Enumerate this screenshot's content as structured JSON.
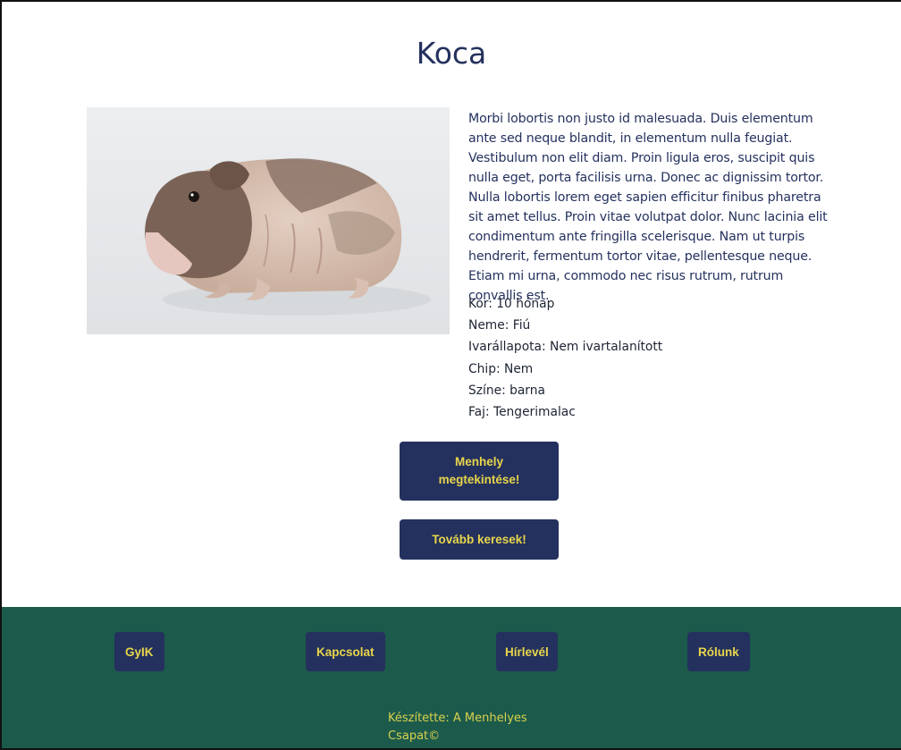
{
  "pet": {
    "name": "Koca",
    "photo_icon": "guinea-pig-photo",
    "description": "Morbi lobortis non justo id malesuada. Duis elementum ante sed neque blandit, in elementum nulla feugiat. Vestibulum non elit diam. Proin ligula eros, suscipit quis nulla eget, porta facilisis urna. Donec ac dignissim tortor. Nulla lobortis lorem eget sapien efficitur finibus pharetra sit amet tellus. Proin vitae volutpat dolor. Nunc lacinia elit condimentum ante fringilla scelerisque. Nam ut turpis hendrerit, fermentum tortor vitae, pellentesque neque. Etiam mi urna, commodo nec risus rutrum, rutrum convallis est.",
    "facts": [
      "Kor: 10 hónap",
      "Neme: Fiú",
      "Ivarállapota: Nem ivartalanított",
      "Chip: Nem",
      "Színe: barna",
      "Faj: Tengerimalac"
    ]
  },
  "actions": {
    "view_shelter": "Menhely megtekintése!",
    "keep_searching": "Tovább keresek!"
  },
  "footer": {
    "links": [
      "GyIK",
      "Kapcsolat",
      "Hírlevél",
      "Rólunk"
    ],
    "credit": "Készítette: A Menhelyes Csapat©"
  },
  "colors": {
    "title": "#24315e",
    "button_bg": "#24315e",
    "button_text": "#e8d54a",
    "footer_bg": "#1c5a4c"
  }
}
